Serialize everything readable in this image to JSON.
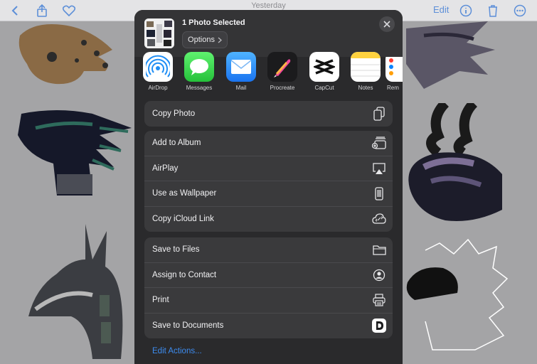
{
  "background": {
    "date_label": "Yesterday",
    "edit_label": "Edit"
  },
  "sheet": {
    "selection_title": "1 Photo Selected",
    "options_label": "Options",
    "apps": [
      {
        "label": "AirDrop",
        "icon": "airdrop-icon"
      },
      {
        "label": "Messages",
        "icon": "messages-icon"
      },
      {
        "label": "Mail",
        "icon": "mail-icon"
      },
      {
        "label": "Procreate",
        "icon": "procreate-icon"
      },
      {
        "label": "CapCut",
        "icon": "capcut-icon"
      },
      {
        "label": "Notes",
        "icon": "notes-icon"
      },
      {
        "label": "Rem",
        "icon": "reminders-icon"
      }
    ],
    "group1": [
      {
        "label": "Copy Photo",
        "icon": "copy-icon"
      }
    ],
    "group2": [
      {
        "label": "Add to Album",
        "icon": "add-album-icon"
      },
      {
        "label": "AirPlay",
        "icon": "airplay-icon"
      },
      {
        "label": "Use as Wallpaper",
        "icon": "phone-icon"
      },
      {
        "label": "Copy iCloud Link",
        "icon": "cloud-link-icon"
      }
    ],
    "group3": [
      {
        "label": "Save to Files",
        "icon": "folder-icon"
      },
      {
        "label": "Assign to Contact",
        "icon": "contact-icon"
      },
      {
        "label": "Print",
        "icon": "printer-icon"
      },
      {
        "label": "Save to Documents",
        "icon": "documents-app-icon"
      }
    ],
    "edit_actions_label": "Edit Actions...",
    "colors": {
      "accent": "#3d8cf0",
      "sheet_bg": "#2a2a2c",
      "row_bg": "#3a3a3c"
    }
  }
}
